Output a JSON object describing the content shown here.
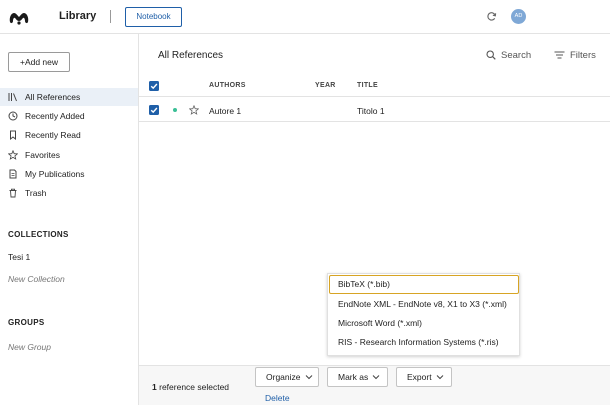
{
  "app": {
    "title": "Library",
    "notebook_label": "Notebook",
    "avatar_initials": "AD",
    "accent_color": "#1f5fa8"
  },
  "sidebar": {
    "add_new_label": "Add new",
    "nav_items": [
      {
        "label": "All References",
        "icon": "books-icon",
        "active": true
      },
      {
        "label": "Recently Added",
        "icon": "clock-icon"
      },
      {
        "label": "Recently Read",
        "icon": "bookmark-icon"
      },
      {
        "label": "Favorites",
        "icon": "star-icon"
      },
      {
        "label": "My Publications",
        "icon": "document-icon"
      },
      {
        "label": "Trash",
        "icon": "trash-icon"
      }
    ],
    "collections_header": "COLLECTIONS",
    "collections": [
      "Tesi 1"
    ],
    "new_collection": "New Collection",
    "groups_header": "GROUPS",
    "new_group": "New Group"
  },
  "main": {
    "title": "All References",
    "search_label": "Search",
    "filters_label": "Filters",
    "columns": {
      "authors": "AUTHORS",
      "year": "YEAR",
      "title": "TITLE"
    },
    "rows": [
      {
        "authors": "Autore 1",
        "year": "",
        "title": "Titolo 1",
        "selected": true,
        "unread": true
      }
    ]
  },
  "export_menu": {
    "items": [
      "BibTeX (*.bib)",
      "EndNote XML - EndNote v8, X1 to X3 (*.xml)",
      "Microsoft Word (*.xml)",
      "RIS - Research Information Systems (*.ris)"
    ]
  },
  "bottom_bar": {
    "count": "1",
    "count_suffix": "reference selected",
    "organize_label": "Organize",
    "mark_as_label": "Mark as",
    "export_label": "Export",
    "delete_label": "Delete"
  }
}
